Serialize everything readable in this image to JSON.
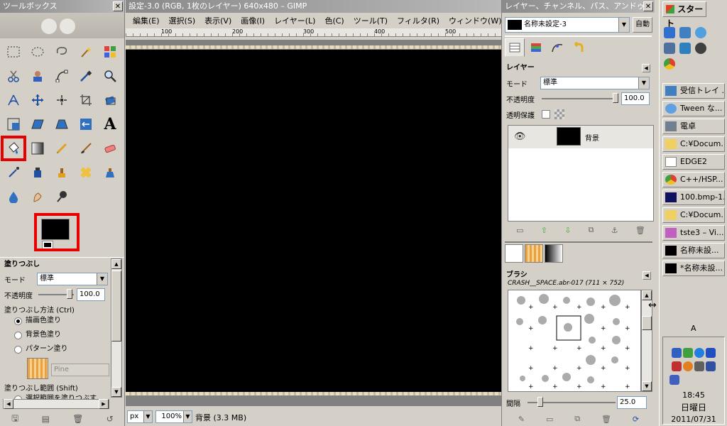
{
  "toolbox": {
    "title": "ツールボックス",
    "options": {
      "title": "塗りつぶし",
      "mode_label": "モード",
      "mode_value": "標準",
      "opacity_label": "不透明度",
      "opacity_value": "100.0",
      "fill_type_label": "塗りつぶし方法 (Ctrl)",
      "fill_fg": "描画色塗り",
      "fill_bg": "背景色塗り",
      "fill_pattern": "パターン塗り",
      "pattern_name": "Pine",
      "area_label": "塗りつぶし範囲 (Shift)",
      "area_selection": "選択範囲を塗りつぶす"
    }
  },
  "image_window": {
    "title": "設定-3.0 (RGB, 1枚のレイヤー) 640x480 – GIMP",
    "menu": [
      "編集(E)",
      "選択(S)",
      "表示(V)",
      "画像(I)",
      "レイヤー(L)",
      "色(C)",
      "ツール(T)",
      "フィルタ(R)",
      "ウィンドウ(W)",
      "ヘ"
    ],
    "ruler_ticks": [
      "100",
      "200",
      "300",
      "400",
      "500"
    ],
    "unit": "px",
    "zoom": "100%",
    "status": "背景 (3.3 MB)"
  },
  "dock": {
    "title": "レイヤー、チャンネル、パス、アンドゥ",
    "image_name": "名称未設定-3",
    "auto_label": "自動",
    "layers": {
      "title": "レイヤー",
      "mode_label": "モード",
      "mode_value": "標準",
      "opacity_label": "不透明度",
      "opacity_value": "100.0",
      "lock_label": "透明保護",
      "layer_name": "背景"
    },
    "brushes": {
      "title": "ブラシ",
      "brush_info": "CRASH__SPACE.abr-017 (711 × 752)",
      "spacing_label": "間隔",
      "spacing_value": "25.0"
    }
  },
  "taskbar": {
    "start_label": "スタート",
    "tasks": [
      "受信トレイ ...",
      "Tween な...",
      "電卓",
      "C:¥Docum...",
      "EDGE2",
      "C++/HSP...",
      "100.bmp-1...",
      "C:¥Docum...",
      "tste3 – Vi...",
      "名称未設...",
      "*名称未設..."
    ],
    "ime": "A",
    "time": "18:45",
    "weekday": "日曜日",
    "date": "2011/07/31"
  },
  "colors": {
    "highlight": "#e60000",
    "canvas": "#000000",
    "title_inactive": "#8a8a8a"
  }
}
